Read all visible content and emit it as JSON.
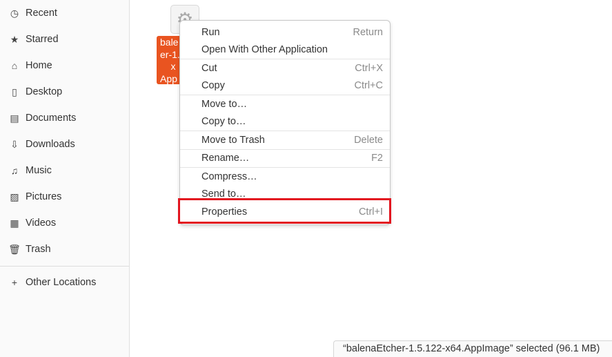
{
  "sidebar": {
    "items": [
      {
        "label": "Recent",
        "icon": "clock-icon",
        "glyph": "◷"
      },
      {
        "label": "Starred",
        "icon": "star-icon",
        "glyph": "★"
      },
      {
        "label": "Home",
        "icon": "home-icon",
        "glyph": "⌂"
      },
      {
        "label": "Desktop",
        "icon": "desktop-icon",
        "glyph": "▯"
      },
      {
        "label": "Documents",
        "icon": "document-icon",
        "glyph": "▤"
      },
      {
        "label": "Downloads",
        "icon": "download-icon",
        "glyph": "⇩"
      },
      {
        "label": "Music",
        "icon": "music-icon",
        "glyph": "♫"
      },
      {
        "label": "Pictures",
        "icon": "picture-icon",
        "glyph": "▨"
      },
      {
        "label": "Videos",
        "icon": "video-icon",
        "glyph": "▦"
      },
      {
        "label": "Trash",
        "icon": "trash-icon",
        "glyph": "🗑"
      }
    ],
    "other_locations": {
      "label": "Other Locations",
      "icon": "plus-icon",
      "glyph": "+"
    }
  },
  "file": {
    "name_fragment": "bale\ner-1.\n    x\nApp",
    "icon": "gear-icon"
  },
  "context_menu": {
    "groups": [
      [
        {
          "label": "Run",
          "accel": "Return"
        },
        {
          "label": "Open With Other Application",
          "accel": ""
        }
      ],
      [
        {
          "label": "Cut",
          "accel": "Ctrl+X"
        },
        {
          "label": "Copy",
          "accel": "Ctrl+C"
        }
      ],
      [
        {
          "label": "Move to…",
          "accel": ""
        },
        {
          "label": "Copy to…",
          "accel": ""
        }
      ],
      [
        {
          "label": "Move to Trash",
          "accel": "Delete"
        }
      ],
      [
        {
          "label": "Rename…",
          "accel": "F2"
        }
      ],
      [
        {
          "label": "Compress…",
          "accel": ""
        },
        {
          "label": "Send to…",
          "accel": ""
        },
        {
          "label": "Properties",
          "accel": "Ctrl+I"
        }
      ]
    ],
    "highlighted": "Properties",
    "highlight_color": "#e2151f"
  },
  "status": {
    "text": "“balenaEtcher-1.5.122-x64.AppImage” selected  (96.1 MB)"
  }
}
